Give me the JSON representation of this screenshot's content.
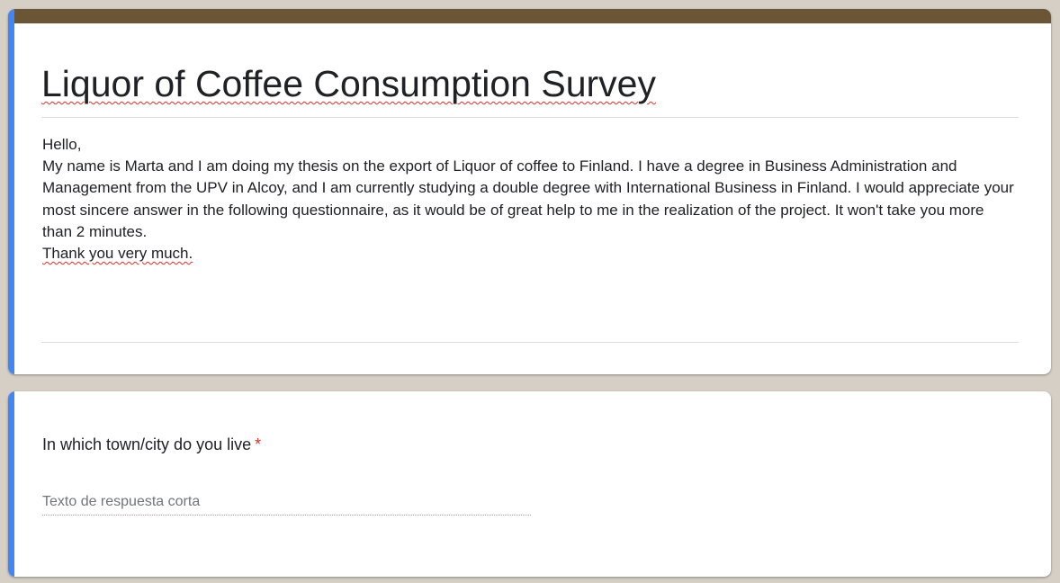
{
  "form": {
    "title": "Liquor of Coffee Consumption Survey",
    "description": [
      "Hello,",
      "My name is Marta and I am doing my thesis on the export of Liquor of coffee to Finland. I have a degree in Business Administration and Management from the UPV in Alcoy, and I am currently studying a double degree with International Business in Finland. I would appreciate your most sincere answer in the following questionnaire, as it would be of great help to me in the realization of the project. It won't take you more than 2 minutes.",
      "Thank you very much."
    ],
    "theme_color": "#6b5537",
    "accent_color": "#4285f4"
  },
  "questions": [
    {
      "label": "In which town/city do you live",
      "required_marker": "*",
      "placeholder": "Texto de respuesta corta",
      "value": ""
    }
  ]
}
